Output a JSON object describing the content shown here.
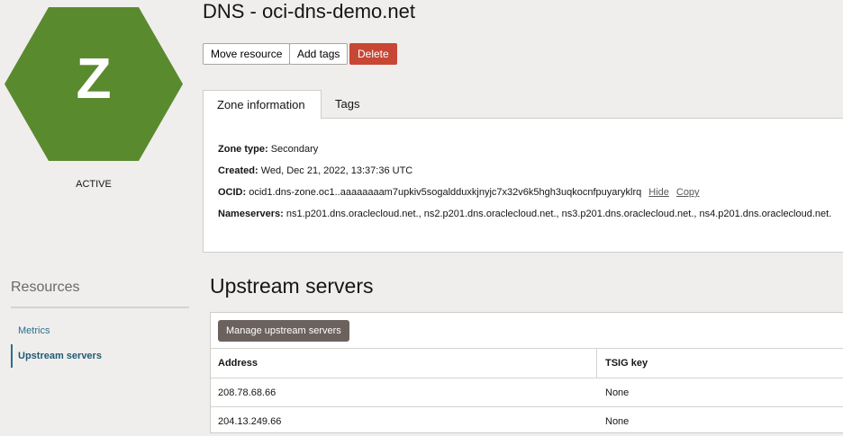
{
  "resource": {
    "letter": "Z",
    "status": "ACTIVE",
    "color": "#5a8a2e"
  },
  "header": {
    "title": "DNS - oci-dns-demo.net",
    "buttons": [
      "Move resource",
      "Add tags",
      "Delete"
    ]
  },
  "tabs": [
    "Zone information",
    "Tags"
  ],
  "zone_info": {
    "zone_type_label": "Zone type:",
    "zone_type": "Secondary",
    "created_label": "Created:",
    "created": "Wed, Dec 21, 2022, 13:37:36 UTC",
    "ocid_label": "OCID:",
    "ocid": "ocid1.dns-zone.oc1..aaaaaaaam7upkiv5sogaldduxkjnyjc7x32v6k5hgh3uqkocnfpuyaryklrq",
    "hide": "Hide",
    "copy": "Copy",
    "nameservers_label": "Nameservers:",
    "nameservers": "ns1.p201.dns.oraclecloud.net., ns2.p201.dns.oraclecloud.net., ns3.p201.dns.oraclecloud.net., ns4.p201.dns.oraclecloud.net."
  },
  "sidebar": {
    "title": "Resources",
    "items": [
      "Metrics",
      "Upstream servers"
    ]
  },
  "upstream": {
    "title": "Upstream servers",
    "manage_button": "Manage upstream servers",
    "columns": [
      "Address",
      "TSIG key"
    ],
    "rows": [
      [
        "208.78.68.66",
        "None"
      ],
      [
        "204.13.249.66",
        "None"
      ]
    ]
  }
}
